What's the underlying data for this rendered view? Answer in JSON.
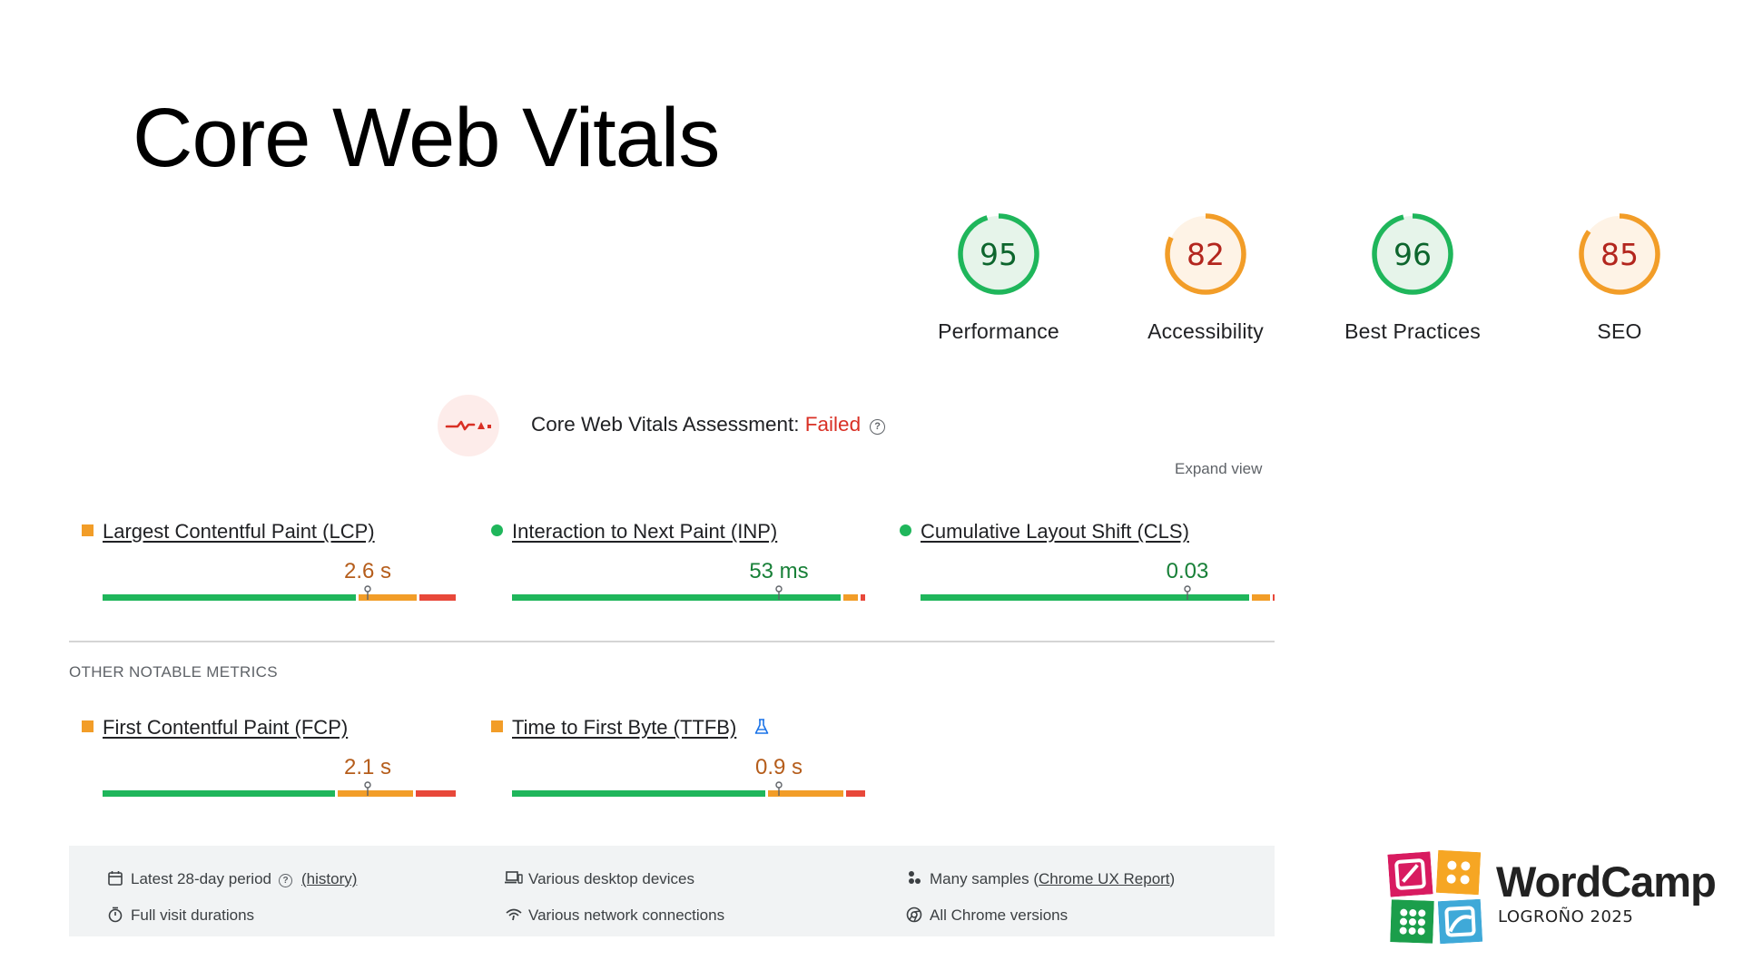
{
  "slide": {
    "title": "Core Web Vitals"
  },
  "scores": [
    {
      "value": "95",
      "label": "Performance",
      "color": "#1fb65b",
      "text_color": "#0d652d",
      "fill": "#e6f4ea",
      "fraction": 0.95
    },
    {
      "value": "82",
      "label": "Accessibility",
      "color": "#f29d28",
      "text_color": "#b3261e",
      "fill": "#fef3e6",
      "fraction": 0.82
    },
    {
      "value": "96",
      "label": "Best Practices",
      "color": "#1fb65b",
      "text_color": "#0d652d",
      "fill": "#e6f4ea",
      "fraction": 0.96
    },
    {
      "value": "85",
      "label": "SEO",
      "color": "#f29d28",
      "text_color": "#b3261e",
      "fill": "#fef3e6",
      "fraction": 0.85
    }
  ],
  "assessment": {
    "prefix": "Core Web Vitals Assessment: ",
    "status": "Failed",
    "status_color": "#d93025",
    "help_icon": "question-circle-icon",
    "expand_label": "Expand view"
  },
  "core_metrics": [
    {
      "name": "Largest Contentful Paint (LCP)",
      "value": "2.6 s",
      "status": "needs-improvement",
      "marker": "orange-square",
      "distribution": {
        "good": 0.72,
        "needs_improvement": 0.17,
        "poor": 0.11
      },
      "pin": 0.745
    },
    {
      "name": "Interaction to Next Paint (INP)",
      "value": "53 ms",
      "status": "good",
      "marker": "green-circle",
      "distribution": {
        "good": 0.93,
        "needs_improvement": 0.05,
        "poor": 0.02
      },
      "pin": 0.75
    },
    {
      "name": "Cumulative Layout Shift (CLS)",
      "value": "0.03",
      "status": "good",
      "marker": "green-circle",
      "distribution": {
        "good": 0.93,
        "needs_improvement": 0.06,
        "poor": 0.01
      },
      "pin": 0.75
    }
  ],
  "other_heading": "OTHER NOTABLE METRICS",
  "other_metrics": [
    {
      "name": "First Contentful Paint (FCP)",
      "value": "2.1 s",
      "status": "needs-improvement",
      "marker": "orange-square",
      "distribution": {
        "good": 0.66,
        "needs_improvement": 0.22,
        "poor": 0.12
      },
      "pin": 0.745
    },
    {
      "name": "Time to First Byte (TTFB)",
      "value": "0.9 s",
      "status": "needs-improvement",
      "marker": "orange-square",
      "experimental_icon": "flask-icon",
      "distribution": {
        "good": 0.72,
        "needs_improvement": 0.22,
        "poor": 0.06
      },
      "pin": 0.75
    }
  ],
  "info": {
    "period": {
      "text": "Latest 28-day period",
      "link": "(history)",
      "icon": "calendar-icon"
    },
    "visits": {
      "text": "Full visit durations",
      "icon": "stopwatch-icon"
    },
    "devices": {
      "text": "Various desktop devices",
      "icon": "devices-icon"
    },
    "network": {
      "text": "Various network connections",
      "icon": "wifi-icon"
    },
    "samples": {
      "text_before": "Many samples (",
      "link": "Chrome UX Report",
      "text_after": ")",
      "icon": "users-icon"
    },
    "versions": {
      "text": "All Chrome versions",
      "icon": "chrome-icon"
    }
  },
  "branding": {
    "name": "WordCamp",
    "sub": "LOGROÑO 2025",
    "tile_colors": [
      "#d81b60",
      "#f6a623",
      "#1b9e4b",
      "#3fa9d8"
    ]
  }
}
